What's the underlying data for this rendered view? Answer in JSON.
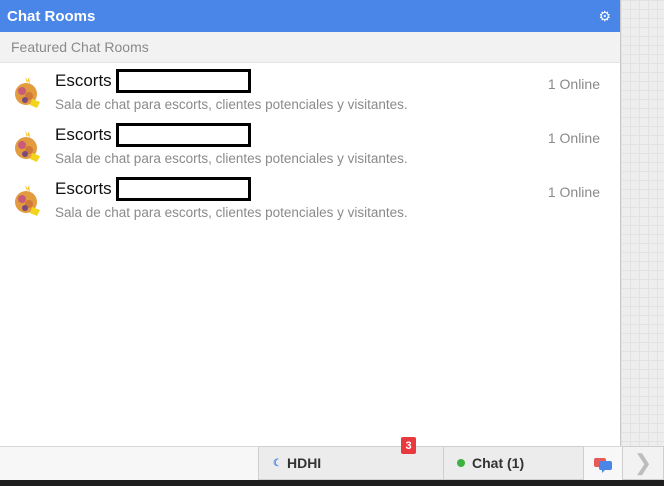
{
  "header": {
    "title": "Chat Rooms",
    "settings_icon": "gear-icon"
  },
  "section": {
    "label": "Featured Chat Rooms"
  },
  "rooms": [
    {
      "name": "Escorts",
      "online": "1 Online",
      "description": "Sala de chat para escorts, clientes potenciales y visitantes.",
      "icon": "room-avatar-icon"
    },
    {
      "name": "Escorts",
      "online": "1 Online",
      "description": "Sala de chat para escorts, clientes potenciales y visitantes.",
      "icon": "room-avatar-icon"
    },
    {
      "name": "Escorts",
      "online": "1 Online",
      "description": "Sala de chat para escorts, clientes potenciales y visitantes.",
      "icon": "room-avatar-icon"
    }
  ],
  "bottom_bar": {
    "tab1": {
      "label": "HDHI",
      "badge": "3",
      "status_icon": "moon-icon"
    },
    "tab2": {
      "label": "Chat (1)",
      "status_icon": "online-dot-icon"
    },
    "bubble_icon": "chat-bubbles-icon",
    "arrow_icon": "chevron-right-icon"
  },
  "colors": {
    "header_bg": "#4a86e8",
    "badge": "#e8393f",
    "online_dot": "#3cb043"
  }
}
